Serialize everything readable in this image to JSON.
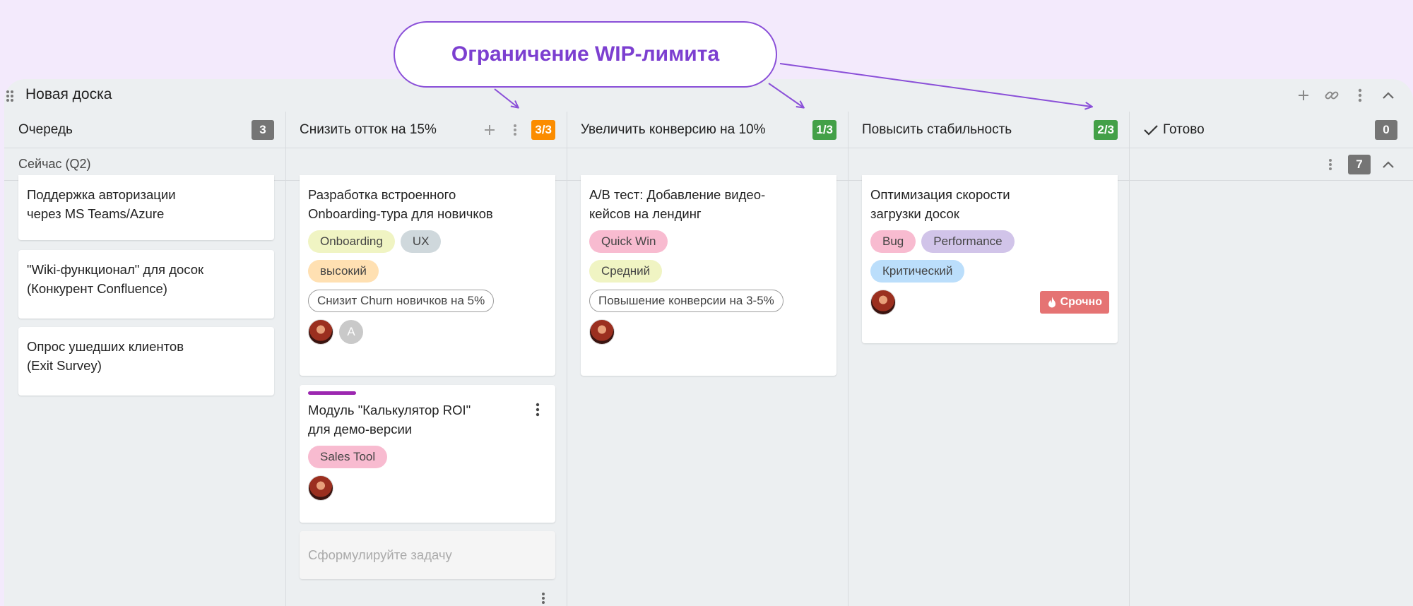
{
  "callout": {
    "text": "Ограничение WIP-лимита"
  },
  "board": {
    "title": "Новая доска",
    "swimlane": {
      "title": "Сейчас (Q2)",
      "count": "7"
    },
    "columns": [
      {
        "title": "Очередь",
        "count": "3"
      },
      {
        "title": "Снизить отток на 15%",
        "wip": "3/3",
        "wip_color": "#fb8c00"
      },
      {
        "title": "Увеличить конверсию на 10%",
        "wip": "1/3",
        "wip_color": "#43a047"
      },
      {
        "title": "Повысить стабильность",
        "wip": "2/3",
        "wip_color": "#43a047"
      },
      {
        "title": "Готово",
        "count": "0"
      }
    ]
  },
  "cards": {
    "queue": [
      {
        "title": "Поддержка авторизации через MS Teams/Azure"
      },
      {
        "title": "\"Wiki-функционал\" для досок (Конкурент Confluence)"
      },
      {
        "title": "Опрос ушедших клиентов (Exit Survey)"
      }
    ],
    "churn": [
      {
        "title": "Разработка встроенного Onboarding-тура для новичков",
        "tags": [
          "Onboarding",
          "UX"
        ],
        "priority": "высокий",
        "metric": "Снизит Churn новичков на 5%",
        "avatar_letter": "A"
      },
      {
        "title": "Модуль \"Калькулятор ROI\" для демо-версии",
        "tags": [
          "Sales Tool"
        ],
        "accent_color": "#9c27b0"
      }
    ],
    "conversion": [
      {
        "title": "A/B тест: Добавление видео-кейсов на лендинг",
        "tags": [
          "Quick Win"
        ],
        "priority": "Средний",
        "metric": "Повышение конверсии на 3-5%"
      }
    ],
    "stability": [
      {
        "title": "Оптимизация скорости загрузки досок",
        "tags": [
          "Bug",
          "Performance"
        ],
        "priority": "Критический",
        "urgent": "Срочно"
      }
    ]
  },
  "draft": {
    "placeholder": "Сформулируйте задачу"
  },
  "colors": {
    "background": "#f3eafc",
    "board": "#eceff1",
    "accent_purple": "#8a4fd8",
    "tag_onboarding": "#f0f4c3",
    "tag_ux": "#cfd8dc",
    "tag_high": "#ffe0b2",
    "tag_sales": "#f8bbd0",
    "tag_quickwin": "#f8bbd0",
    "tag_medium": "#f0f4c3",
    "tag_bug": "#f8bbd0",
    "tag_performance": "#d1c4e9",
    "tag_critical": "#bbdefb",
    "urgent": "#e57373"
  }
}
